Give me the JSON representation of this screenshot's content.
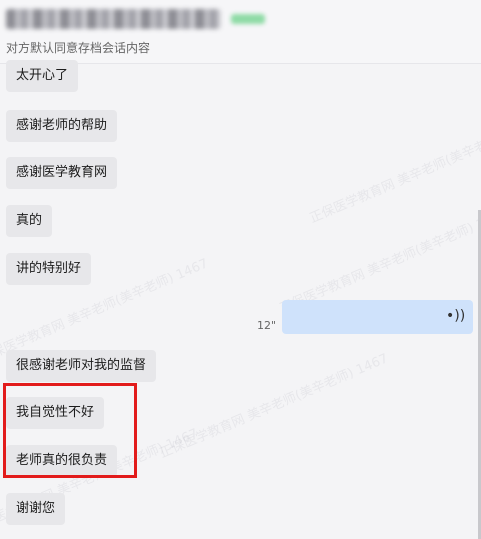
{
  "header": {
    "subtitle": "对方默认同意存档会话内容"
  },
  "messages": [
    "太开心了",
    "感谢老师的帮助",
    "感谢医学教育网",
    "真的",
    "讲的特别好",
    "很感谢老师对我的监督",
    "我自觉性不好",
    "老师真的很负责",
    "谢谢您"
  ],
  "voice_message": {
    "duration": "12\"",
    "icon": "voice-wave-icon"
  },
  "watermarks": [
    "正保医学教育网 美辛老师(美辛老师) 1467"
  ],
  "colors": {
    "incoming_bubble": "#e7e7ea",
    "outgoing_bubble": "#cfe2fb",
    "highlight": "#e21b1b"
  }
}
